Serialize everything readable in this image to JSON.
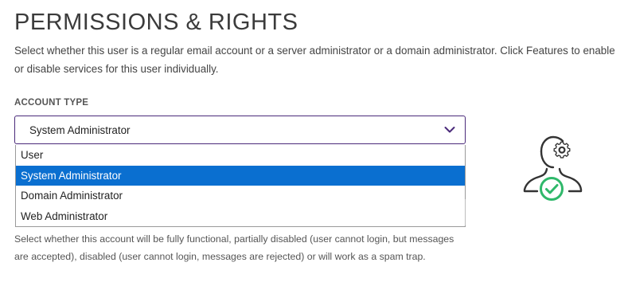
{
  "header": {
    "title": "PERMISSIONS & RIGHTS",
    "description": "Select whether this user is a regular email account or a server administrator or a domain administrator. Click Features to enable or disable services for this user individually."
  },
  "account_type": {
    "label": "ACCOUNT TYPE",
    "selected_value": "System Administrator",
    "options": [
      {
        "label": "User",
        "selected": false
      },
      {
        "label": "System Administrator",
        "selected": true
      },
      {
        "label": "Domain Administrator",
        "selected": false
      },
      {
        "label": "Web Administrator",
        "selected": false
      }
    ]
  },
  "status_help": "Select whether this account will be fully functional, partially disabled (user cannot login, but messages are accepted), disabled (user cannot login, messages are rejected) or will work as a spam trap.",
  "icons": {
    "chevron": "chevron-down-icon",
    "illustration": "user-gear-check-icon"
  },
  "colors": {
    "accent": "#4a2a7a",
    "selection": "#0a6fd0",
    "check": "#2fb86a"
  }
}
